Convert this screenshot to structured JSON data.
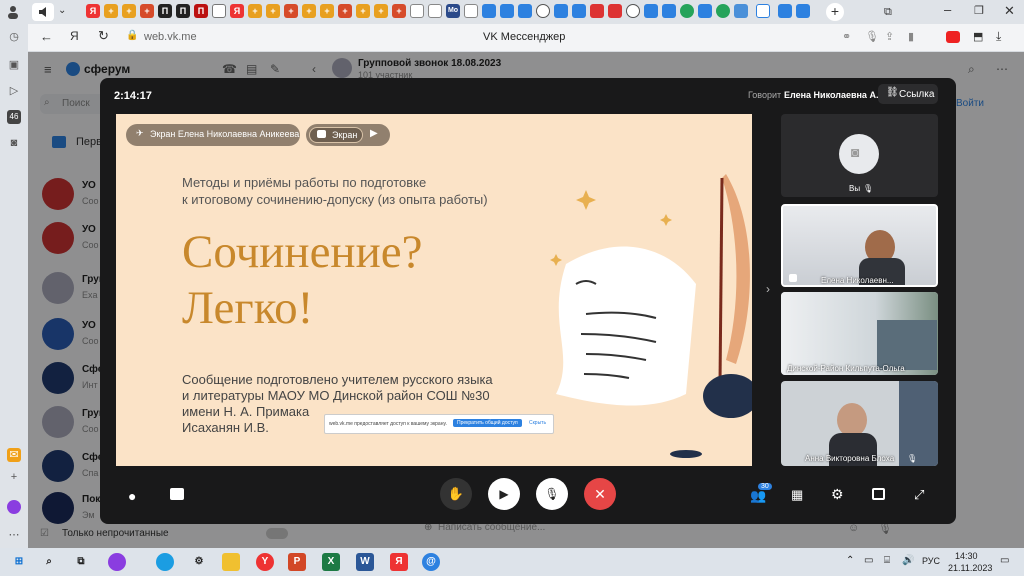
{
  "browser": {
    "url": "web.vk.me",
    "page_title": "VK Мессенджер",
    "tab_icon_labels": [
      "Я",
      "М",
      "И",
      "П",
      "П",
      "Я",
      "Мо"
    ]
  },
  "messenger": {
    "brand": "сферум",
    "search_placeholder": "Поиск",
    "chat_header_title": "Групповой звонок 18.08.2023",
    "chat_header_sub": "101 участник",
    "join_button": "Войти",
    "message_placeholder": "Написать сообщение...",
    "unread_toggle_label": "Только непрочитанные",
    "folder_label": "Перв",
    "chat_rows": [
      {
        "name": "УО",
        "preview": "Соо"
      },
      {
        "name": "УО",
        "preview": "Соо"
      },
      {
        "name": "Груп",
        "preview": "Exa"
      },
      {
        "name": "УО",
        "preview": "Соо"
      },
      {
        "name": "Сфе",
        "preview": "Инт"
      },
      {
        "name": "Груп",
        "preview": "Соо"
      },
      {
        "name": "Сфе",
        "preview": "Спа"
      },
      {
        "name": "Пок",
        "preview": "Эм"
      }
    ]
  },
  "call": {
    "timer": "2:14:17",
    "speaker_prefix": "Говорит",
    "speaker_name": "Елена Николаевна А.",
    "link_button": "Ссылка",
    "screen_owner_label": "Экран Елена Николаевна Аникеева",
    "screen_toggle_label": "Экран",
    "participants_count": "30",
    "slide": {
      "subtitle_line1": "Методы и приёмы работы по подготовке",
      "subtitle_line2": "к итоговому сочинению-допуску (из опыта работы)",
      "title_line1": "Сочинение?",
      "title_line2": "Легко!",
      "author_line1": "Сообщение подготовлено учителем русского языка",
      "author_line2": "и литературы МАОУ МО Динской район СОШ №30",
      "author_line3": "имени Н. А. Примака",
      "author_line4": "Исаханян И.В."
    },
    "share_notice": {
      "text": "web.vk.me предоставляет доступ к вашему экрану.",
      "stop_button": "Прекратить общий доступ",
      "hide_button": "Скрыть"
    },
    "tiles": [
      {
        "name": "Вы"
      },
      {
        "name": "Елена Николаевн..."
      },
      {
        "name": "Динской-Район Кильпута-Ольга"
      },
      {
        "name": "Анна Викторовна Блоха"
      }
    ]
  },
  "taskbar": {
    "language": "РУС",
    "time": "14:30",
    "date": "21.11.2023"
  },
  "colors": {
    "slide_bg": "#fbe3c7",
    "slide_title": "#c8882c",
    "end_call": "#e64646",
    "accent_blue": "#2d81e0"
  }
}
